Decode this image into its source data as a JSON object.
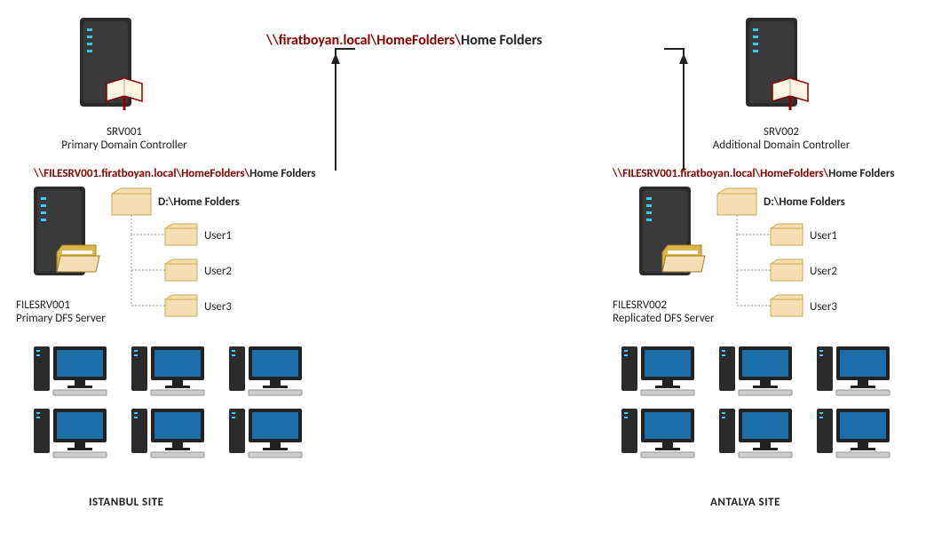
{
  "dfs_namespace": {
    "path_prefix": "\\\\firatboyan.local\\HomeFolders\\",
    "path_suffix": "Home Folders"
  },
  "istanbul": {
    "dc": {
      "name": "SRV001",
      "role": "Primary Domain Controller"
    },
    "file_server": {
      "name": "FILESRV001",
      "role": "Primary DFS Server"
    },
    "share_path_prefix": "\\\\FILESRV001.firatboyan.local\\HomeFolders\\",
    "share_path_suffix": "Home Folders",
    "local_root": "D:\\Home Folders",
    "users": [
      "User1",
      "User2",
      "User3"
    ],
    "site_label": "ISTANBUL SITE"
  },
  "antalya": {
    "dc": {
      "name": "SRV002",
      "role": "Additional Domain Controller"
    },
    "file_server": {
      "name": "FILESRV002",
      "role": "Replicated DFS Server"
    },
    "share_path_prefix": "\\\\FILESRV001.firatboyan.local\\HomeFolders\\",
    "share_path_suffix": "Home Folders",
    "local_root": "D:\\Home Folders",
    "users": [
      "User1",
      "User2",
      "User3"
    ],
    "site_label": "ANTALYA SITE"
  }
}
